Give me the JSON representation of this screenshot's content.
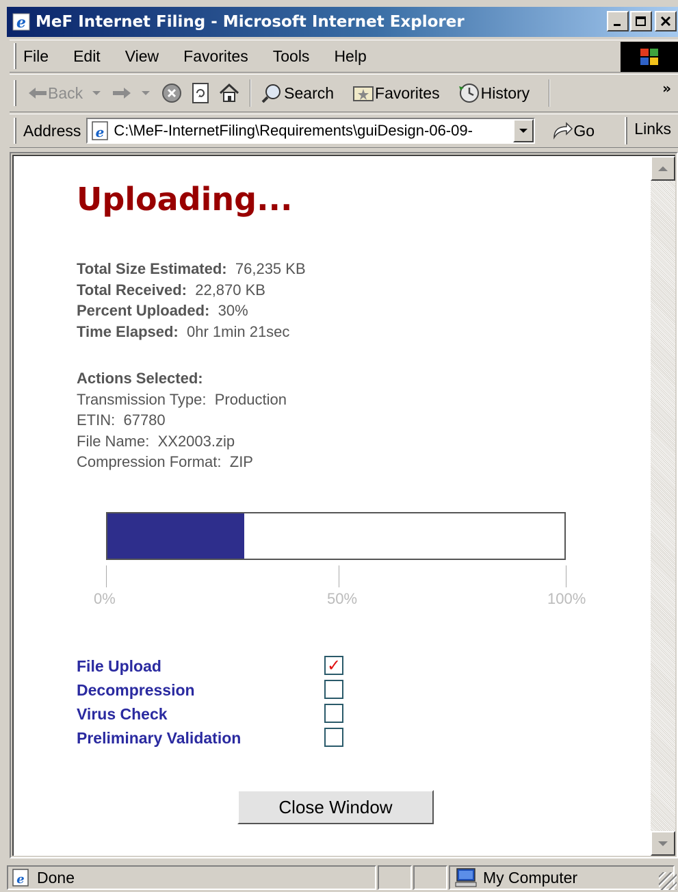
{
  "window": {
    "title": "MeF Internet Filing - Microsoft Internet Explorer",
    "minimize_label": "_",
    "maximize_label": "□",
    "close_label": "X"
  },
  "menu": {
    "items": [
      {
        "label": "File"
      },
      {
        "label": "Edit"
      },
      {
        "label": "View"
      },
      {
        "label": "Favorites"
      },
      {
        "label": "Tools"
      },
      {
        "label": "Help"
      }
    ]
  },
  "toolbar": {
    "back_label": "Back",
    "search_label": "Search",
    "favorites_label": "Favorites",
    "history_label": "History",
    "more_label": "»"
  },
  "address": {
    "label": "Address",
    "value": "C:\\MeF-InternetFiling\\Requirements\\guiDesign-06-09-",
    "go_label": "Go",
    "links_label": "Links"
  },
  "page": {
    "title": "Uploading...",
    "stats": [
      {
        "label": "Total Size Estimated:",
        "value": "76,235 KB"
      },
      {
        "label": "Total Received:",
        "value": "22,870 KB"
      },
      {
        "label": "Percent Uploaded:",
        "value": "30%"
      },
      {
        "label": "Time Elapsed:",
        "value": "0hr 1min 21sec"
      }
    ],
    "actions_header": "Actions Selected:",
    "actions": [
      {
        "label": "Transmission Type:",
        "value": "Production"
      },
      {
        "label": "ETIN:",
        "value": "67780"
      },
      {
        "label": "File Name:",
        "value": "XX2003.zip"
      },
      {
        "label": "Compression Format:",
        "value": "ZIP"
      }
    ],
    "progress": {
      "fraction": 0.3,
      "fill_color": "#2e2e8c",
      "ticks": [
        "0%",
        "50%",
        "100%"
      ]
    },
    "steps": [
      {
        "label": "File Upload",
        "checked": true
      },
      {
        "label": "Decompression",
        "checked": false
      },
      {
        "label": "Virus Check",
        "checked": false
      },
      {
        "label": "Preliminary Validation",
        "checked": false
      }
    ],
    "close_button": "Close Window"
  },
  "status": {
    "text": "Done",
    "zone": "My Computer"
  },
  "colors": {
    "title_red": "#990000",
    "step_blue": "#2a2aa0",
    "check_red": "#e01010"
  },
  "icons": [
    "ie-logo-icon",
    "back-arrow-icon",
    "forward-arrow-icon",
    "stop-icon",
    "refresh-icon",
    "home-icon",
    "search-icon",
    "favorites-icon",
    "history-icon",
    "page-icon",
    "go-arrow-icon",
    "computer-icon",
    "windows-logo-icon"
  ]
}
